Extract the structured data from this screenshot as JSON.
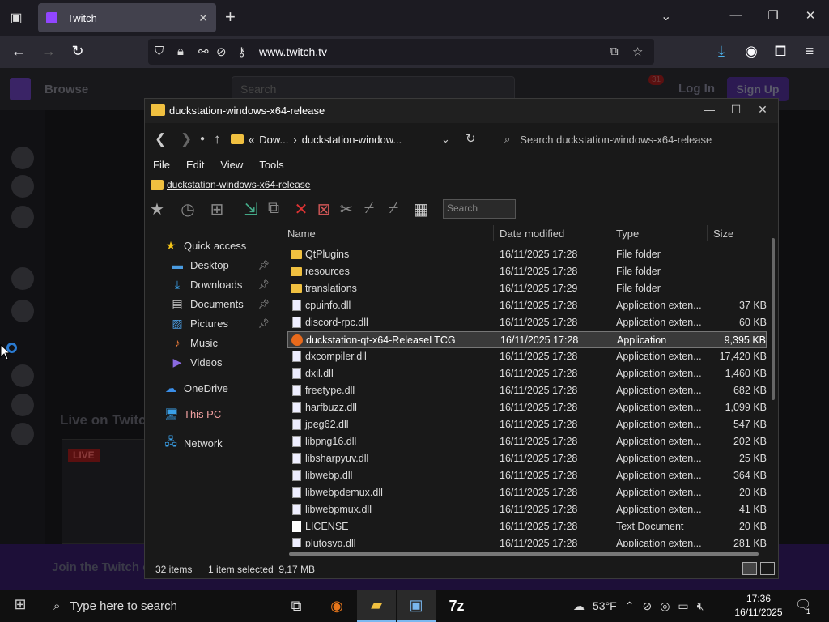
{
  "browser": {
    "tab_title": "Twitch",
    "url": "www.twitch.tv"
  },
  "twitch": {
    "browse": "Browse",
    "search_placeholder": "Search",
    "notif_count": "31",
    "login": "Log In",
    "signup": "Sign Up",
    "live_on": "Live on Twitch",
    "live_badge": "LIVE",
    "join_text": "Join the Twitch c"
  },
  "explorer": {
    "title": "duckstation-windows-x64-release",
    "breadcrumb_parent": "Dow...",
    "breadcrumb_current": "duckstation-window...",
    "search_placeholder": "Search duckstation-windows-x64-release",
    "menu": [
      "File",
      "Edit",
      "View",
      "Tools"
    ],
    "location": "duckstation-windows-x64-release",
    "toolbar_search": "Search",
    "nav": {
      "quick_access": "Quick access",
      "desktop": "Desktop",
      "downloads": "Downloads",
      "documents": "Documents",
      "pictures": "Pictures",
      "music": "Music",
      "videos": "Videos",
      "onedrive": "OneDrive",
      "this_pc": "This PC",
      "network": "Network"
    },
    "columns": {
      "name": "Name",
      "date": "Date modified",
      "type": "Type",
      "size": "Size"
    },
    "files": [
      {
        "name": "QtPlugins",
        "date": "16/11/2025 17:28",
        "type": "File folder",
        "size": "",
        "kind": "folder"
      },
      {
        "name": "resources",
        "date": "16/11/2025 17:28",
        "type": "File folder",
        "size": "",
        "kind": "folder"
      },
      {
        "name": "translations",
        "date": "16/11/2025 17:29",
        "type": "File folder",
        "size": "",
        "kind": "folder"
      },
      {
        "name": "cpuinfo.dll",
        "date": "16/11/2025 17:28",
        "type": "Application exten...",
        "size": "37 KB",
        "kind": "dll"
      },
      {
        "name": "discord-rpc.dll",
        "date": "16/11/2025 17:28",
        "type": "Application exten...",
        "size": "60 KB",
        "kind": "dll"
      },
      {
        "name": "duckstation-qt-x64-ReleaseLTCG",
        "date": "16/11/2025 17:28",
        "type": "Application",
        "size": "9,395 KB",
        "kind": "app"
      },
      {
        "name": "dxcompiler.dll",
        "date": "16/11/2025 17:28",
        "type": "Application exten...",
        "size": "17,420 KB",
        "kind": "dll"
      },
      {
        "name": "dxil.dll",
        "date": "16/11/2025 17:28",
        "type": "Application exten...",
        "size": "1,460 KB",
        "kind": "dll"
      },
      {
        "name": "freetype.dll",
        "date": "16/11/2025 17:28",
        "type": "Application exten...",
        "size": "682 KB",
        "kind": "dll"
      },
      {
        "name": "harfbuzz.dll",
        "date": "16/11/2025 17:28",
        "type": "Application exten...",
        "size": "1,099 KB",
        "kind": "dll"
      },
      {
        "name": "jpeg62.dll",
        "date": "16/11/2025 17:28",
        "type": "Application exten...",
        "size": "547 KB",
        "kind": "dll"
      },
      {
        "name": "libpng16.dll",
        "date": "16/11/2025 17:28",
        "type": "Application exten...",
        "size": "202 KB",
        "kind": "dll"
      },
      {
        "name": "libsharpyuv.dll",
        "date": "16/11/2025 17:28",
        "type": "Application exten...",
        "size": "25 KB",
        "kind": "dll"
      },
      {
        "name": "libwebp.dll",
        "date": "16/11/2025 17:28",
        "type": "Application exten...",
        "size": "364 KB",
        "kind": "dll"
      },
      {
        "name": "libwebpdemux.dll",
        "date": "16/11/2025 17:28",
        "type": "Application exten...",
        "size": "20 KB",
        "kind": "dll"
      },
      {
        "name": "libwebpmux.dll",
        "date": "16/11/2025 17:28",
        "type": "Application exten...",
        "size": "41 KB",
        "kind": "dll"
      },
      {
        "name": "LICENSE",
        "date": "16/11/2025 17:28",
        "type": "Text Document",
        "size": "20 KB",
        "kind": "doc"
      },
      {
        "name": "plutosvg.dll",
        "date": "16/11/2025 17:28",
        "type": "Application exten...",
        "size": "281 KB",
        "kind": "dll"
      }
    ],
    "selected_index": 5,
    "status": {
      "items": "32 items",
      "selected": "1 item selected  9,17 MB"
    }
  },
  "taskbar": {
    "search_placeholder": "Type here to search",
    "weather": "53°F",
    "time": "17:36",
    "date": "16/11/2025",
    "notif_count": "1"
  }
}
